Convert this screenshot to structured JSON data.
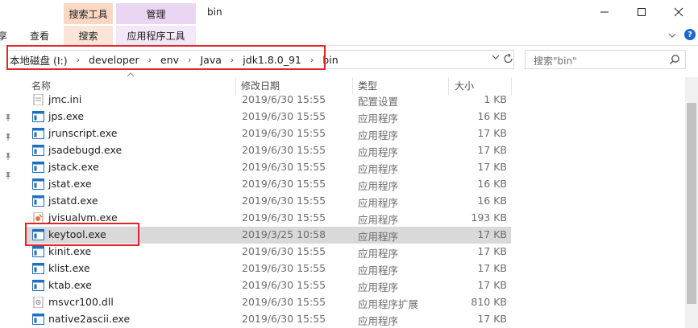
{
  "window": {
    "title": "bin",
    "context_tabs": {
      "search_tools": "搜索工具",
      "manage": "管理"
    },
    "min_icon": "minimize-icon",
    "max_icon": "maximize-icon",
    "close_icon": "close-icon"
  },
  "ribbon": {
    "tabs": {
      "share": "享",
      "view": "查看",
      "search": "搜索",
      "app_tools": "应用程序工具"
    }
  },
  "address": {
    "crumbs": [
      "本地磁盘 (I:)",
      "developer",
      "env",
      "Java",
      "jdk1.8.0_91",
      "bin"
    ],
    "separator": "›"
  },
  "search": {
    "placeholder": "搜索\"bin\""
  },
  "columns": {
    "name": "名称",
    "date": "修改日期",
    "type": "类型",
    "size": "大小"
  },
  "files": [
    {
      "name": "jmc.ini",
      "date": "2019/6/30 15:55",
      "type": "配置设置",
      "size": "1 KB",
      "icon": "ini-file-icon"
    },
    {
      "name": "jps.exe",
      "date": "2019/6/30 15:55",
      "type": "应用程序",
      "size": "16 KB",
      "icon": "exe-file-icon"
    },
    {
      "name": "jrunscript.exe",
      "date": "2019/6/30 15:55",
      "type": "应用程序",
      "size": "17 KB",
      "icon": "exe-file-icon"
    },
    {
      "name": "jsadebugd.exe",
      "date": "2019/6/30 15:55",
      "type": "应用程序",
      "size": "17 KB",
      "icon": "exe-file-icon"
    },
    {
      "name": "jstack.exe",
      "date": "2019/6/30 15:55",
      "type": "应用程序",
      "size": "17 KB",
      "icon": "exe-file-icon"
    },
    {
      "name": "jstat.exe",
      "date": "2019/6/30 15:55",
      "type": "应用程序",
      "size": "16 KB",
      "icon": "exe-file-icon"
    },
    {
      "name": "jstatd.exe",
      "date": "2019/6/30 15:55",
      "type": "应用程序",
      "size": "16 KB",
      "icon": "exe-file-icon"
    },
    {
      "name": "jvisualvm.exe",
      "date": "2019/6/30 15:55",
      "type": "应用程序",
      "size": "193 KB",
      "icon": "jvisualvm-icon"
    },
    {
      "name": "keytool.exe",
      "date": "2019/3/25 10:58",
      "type": "应用程序",
      "size": "17 KB",
      "icon": "exe-file-icon"
    },
    {
      "name": "kinit.exe",
      "date": "2019/6/30 15:55",
      "type": "应用程序",
      "size": "17 KB",
      "icon": "exe-file-icon"
    },
    {
      "name": "klist.exe",
      "date": "2019/6/30 15:55",
      "type": "应用程序",
      "size": "17 KB",
      "icon": "exe-file-icon"
    },
    {
      "name": "ktab.exe",
      "date": "2019/6/30 15:55",
      "type": "应用程序",
      "size": "17 KB",
      "icon": "exe-file-icon"
    },
    {
      "name": "msvcr100.dll",
      "date": "2019/6/30 15:55",
      "type": "应用程序扩展",
      "size": "810 KB",
      "icon": "dll-file-icon"
    },
    {
      "name": "native2ascii.exe",
      "date": "2019/6/30 15:55",
      "type": "应用程序",
      "size": "17 KB",
      "icon": "exe-file-icon"
    }
  ],
  "colors": {
    "highlight": "#e0262b",
    "selected_row": "#d9d9d9",
    "search_ctx": "#f9d7c2",
    "manage_ctx": "#ead6f3"
  }
}
